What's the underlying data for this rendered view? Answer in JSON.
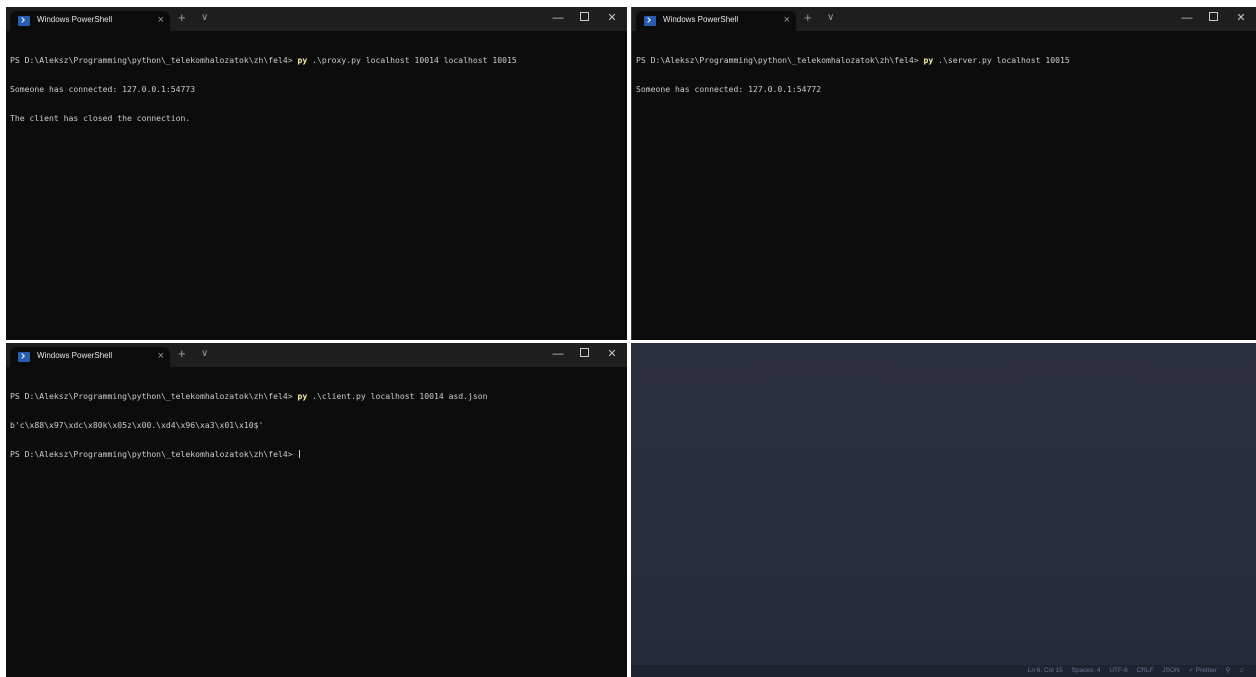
{
  "windows": [
    {
      "tab_title": "Windows PowerShell",
      "lines": [
        {
          "prompt": "PS D:\\Aleksz\\Programming\\python\\_telekomhalozatok\\zh\\fel4> ",
          "cmd": "py",
          "args": " .\\proxy.py localhost 10014 localhost 10015"
        },
        {
          "text": "Someone has connected: 127.0.0.1:54773"
        },
        {
          "text": "The client has closed the connection."
        }
      ]
    },
    {
      "tab_title": "Windows PowerShell",
      "lines": [
        {
          "prompt": "PS D:\\Aleksz\\Programming\\python\\_telekomhalozatok\\zh\\fel4> ",
          "cmd": "py",
          "args": " .\\server.py localhost 10015"
        },
        {
          "text": "Someone has connected: 127.0.0.1:54772"
        }
      ]
    },
    {
      "tab_title": "Windows PowerShell",
      "lines": [
        {
          "prompt": "PS D:\\Aleksz\\Programming\\python\\_telekomhalozatok\\zh\\fel4> ",
          "cmd": "py",
          "args": " .\\client.py localhost 10014 asd.json"
        },
        {
          "text": "b'c\\x88\\x97\\xdc\\x80k\\x05z\\x00.\\xd4\\x96\\xa3\\x01\\x10$'"
        },
        {
          "prompt": "PS D:\\Aleksz\\Programming\\python\\_telekomhalozatok\\zh\\fel4> ",
          "cursor": true
        }
      ]
    }
  ],
  "controls": {
    "new_tab": "+",
    "dropdown": "∨",
    "minimize": "—",
    "close": "✕",
    "tab_close": "×"
  },
  "icons": {
    "tab": "powershell-icon"
  },
  "statusbar": {
    "position": "Ln 6, Col 15",
    "spaces": "Spaces: 4",
    "encoding": "UTF-8",
    "eol": "CRLF",
    "language": "JSON",
    "prettier": "✓ Prettier",
    "live_share": "⚲",
    "bell": "♫"
  },
  "colors": {
    "terminal_bg": "#0c0c0c",
    "command_highlight": "#f9f1a5",
    "editor_bg": "#2a2d3e"
  }
}
